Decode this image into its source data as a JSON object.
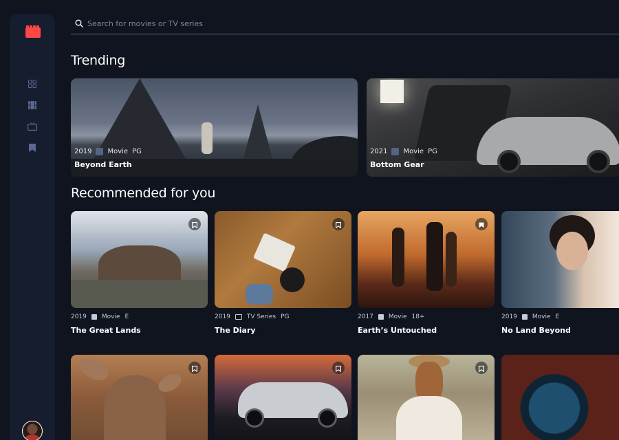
{
  "search": {
    "placeholder": "Search for movies or TV series"
  },
  "sidebar": {
    "items": [
      {
        "icon": "grid-icon",
        "label": "Home"
      },
      {
        "icon": "film-icon",
        "label": "Movies"
      },
      {
        "icon": "tv-icon",
        "label": "TV Series"
      },
      {
        "icon": "bookmark-icon",
        "label": "Bookmarks"
      }
    ]
  },
  "colors": {
    "background": "#10141E",
    "surface": "#161D2F",
    "accent": "#FC4747",
    "muted": "#5A698F"
  },
  "trending": {
    "title": "Trending",
    "items": [
      {
        "year": "2019",
        "category": "Movie",
        "rating": "PG",
        "title": "Beyond Earth"
      },
      {
        "year": "2021",
        "category": "Movie",
        "rating": "PG",
        "title": "Bottom Gear"
      }
    ]
  },
  "recommended": {
    "title": "Recommended for you",
    "items": [
      {
        "year": "2019",
        "category": "Movie",
        "rating": "E",
        "title": "The Great Lands"
      },
      {
        "year": "2019",
        "category": "TV Series",
        "rating": "PG",
        "title": "The Diary"
      },
      {
        "year": "2017",
        "category": "Movie",
        "rating": "18+",
        "title": "Earth’s Untouched"
      },
      {
        "year": "2019",
        "category": "Movie",
        "rating": "E",
        "title": "No Land Beyond"
      }
    ]
  }
}
